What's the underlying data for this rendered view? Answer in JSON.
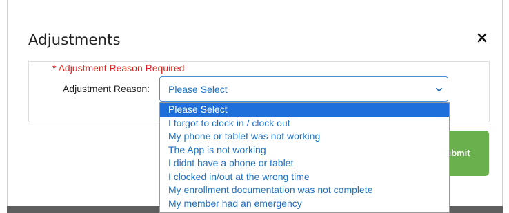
{
  "modal": {
    "title": "Adjustments",
    "close_icon": "close-icon",
    "close_glyph": "✕",
    "required_text": "* Adjustment Reason Required",
    "reason_label": "Adjustment Reason:",
    "select_value": "Please Select",
    "submit_label": "Submit",
    "colors": {
      "required": "#e0201f",
      "link": "#1d70c4",
      "selected_bg": "#1e6fd9",
      "submit_bg": "#6ab04c"
    }
  },
  "dropdown": {
    "options": [
      "Please Select",
      "I forgot to clock in / clock out",
      "My phone or tablet was not working",
      "The App is not working",
      "I didnt have a phone or tablet",
      "I clocked in/out at the wrong time",
      "My enrollment documentation was not complete",
      "My member had an emergency"
    ],
    "selected_index": 0
  }
}
